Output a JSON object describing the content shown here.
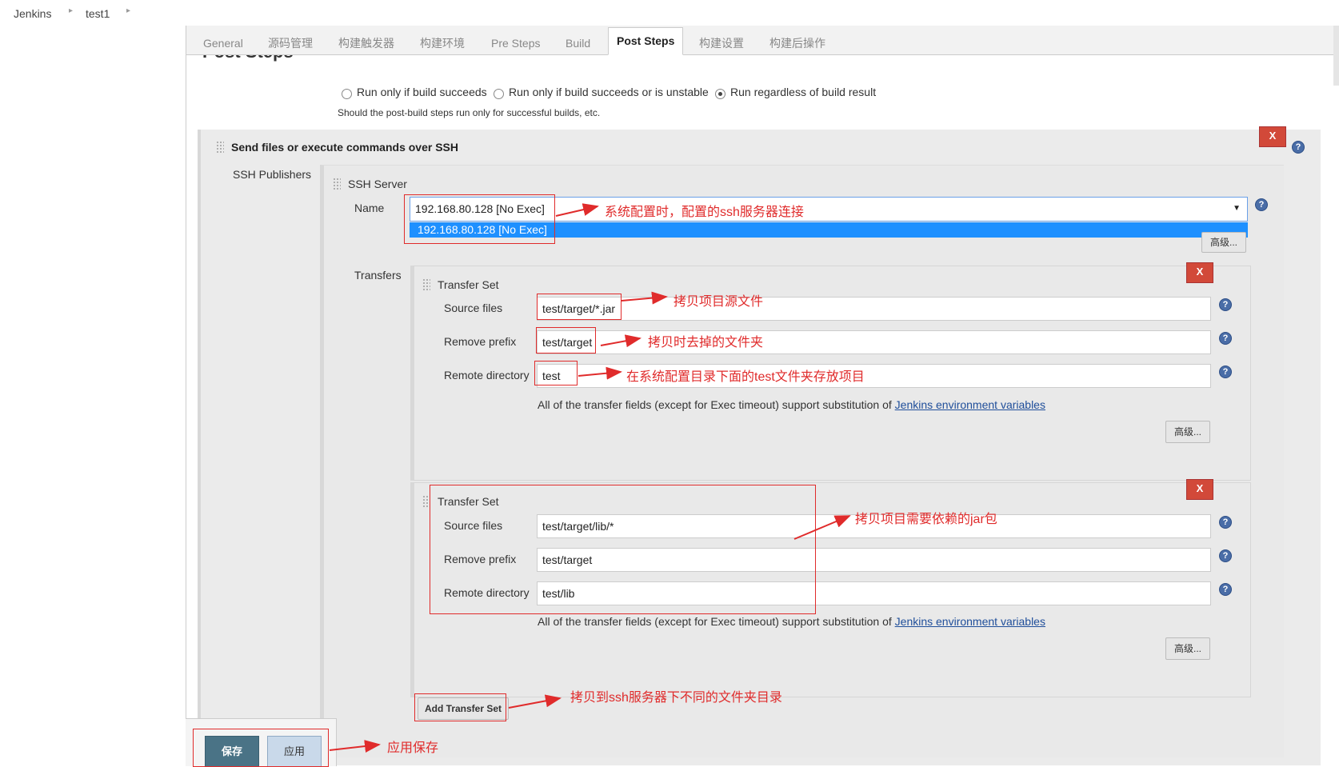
{
  "breadcrumb": {
    "root": "Jenkins",
    "job": "test1"
  },
  "tabs": [
    "General",
    "源码管理",
    "构建触发器",
    "构建环境",
    "Pre Steps",
    "Build",
    "Post Steps",
    "构建设置",
    "构建后操作"
  ],
  "section_title": "Post Steps",
  "post_steps": {
    "options": [
      "Run only if build succeeds",
      "Run only if build succeeds or is unstable",
      "Run regardless of build result"
    ],
    "selected": "Run regardless of build result",
    "description": "Should the post-build steps run only for successful builds, etc."
  },
  "ssh": {
    "title": "Send files or execute commands over SSH",
    "publishers_label": "SSH Publishers",
    "server_label": "SSH Server",
    "name_label": "Name",
    "name_value": "192.168.80.128 [No Exec]",
    "dropdown_option": "192.168.80.128 [No Exec]",
    "advanced_label": "高级...",
    "transfers_label": "Transfers",
    "transfer_sets": [
      {
        "title": "Transfer Set",
        "source_label": "Source files",
        "source": "test/target/*.jar",
        "prefix_label": "Remove prefix",
        "prefix": "test/target",
        "remote_label": "Remote directory",
        "remote": "test",
        "note": "All of the transfer fields (except for Exec timeout) support substitution of ",
        "note_link": "Jenkins environment variables",
        "advanced": "高级..."
      },
      {
        "title": "Transfer Set",
        "source_label": "Source files",
        "source": "test/target/lib/*",
        "prefix_label": "Remove prefix",
        "prefix": "test/target",
        "remote_label": "Remote directory",
        "remote": "test/lib",
        "note": "All of the transfer fields (except for Exec timeout) support substitution of ",
        "note_link": "Jenkins environment variables",
        "advanced": "高级..."
      }
    ],
    "add_transfer_set": "Add Transfer Set",
    "delete": "X",
    "help": "?"
  },
  "buttons": {
    "save": "保存",
    "apply": "应用"
  },
  "annotations": {
    "server": "系统配置时，配置的ssh服务器连接",
    "source": "拷贝项目源文件",
    "prefix": "拷贝时去掉的文件夹",
    "remote": "在系统配置目录下面的test文件夹存放项目",
    "deps": "拷贝项目需要依赖的jar包",
    "add": "拷贝到ssh服务器下不同的文件夹目录",
    "save": "应用保存"
  },
  "colors": {
    "annotation": "#e02b2b",
    "save_button": "#4a7386",
    "apply_button": "#c9d9ea",
    "delete_button": "#d24939",
    "selection": "#1e90ff"
  }
}
